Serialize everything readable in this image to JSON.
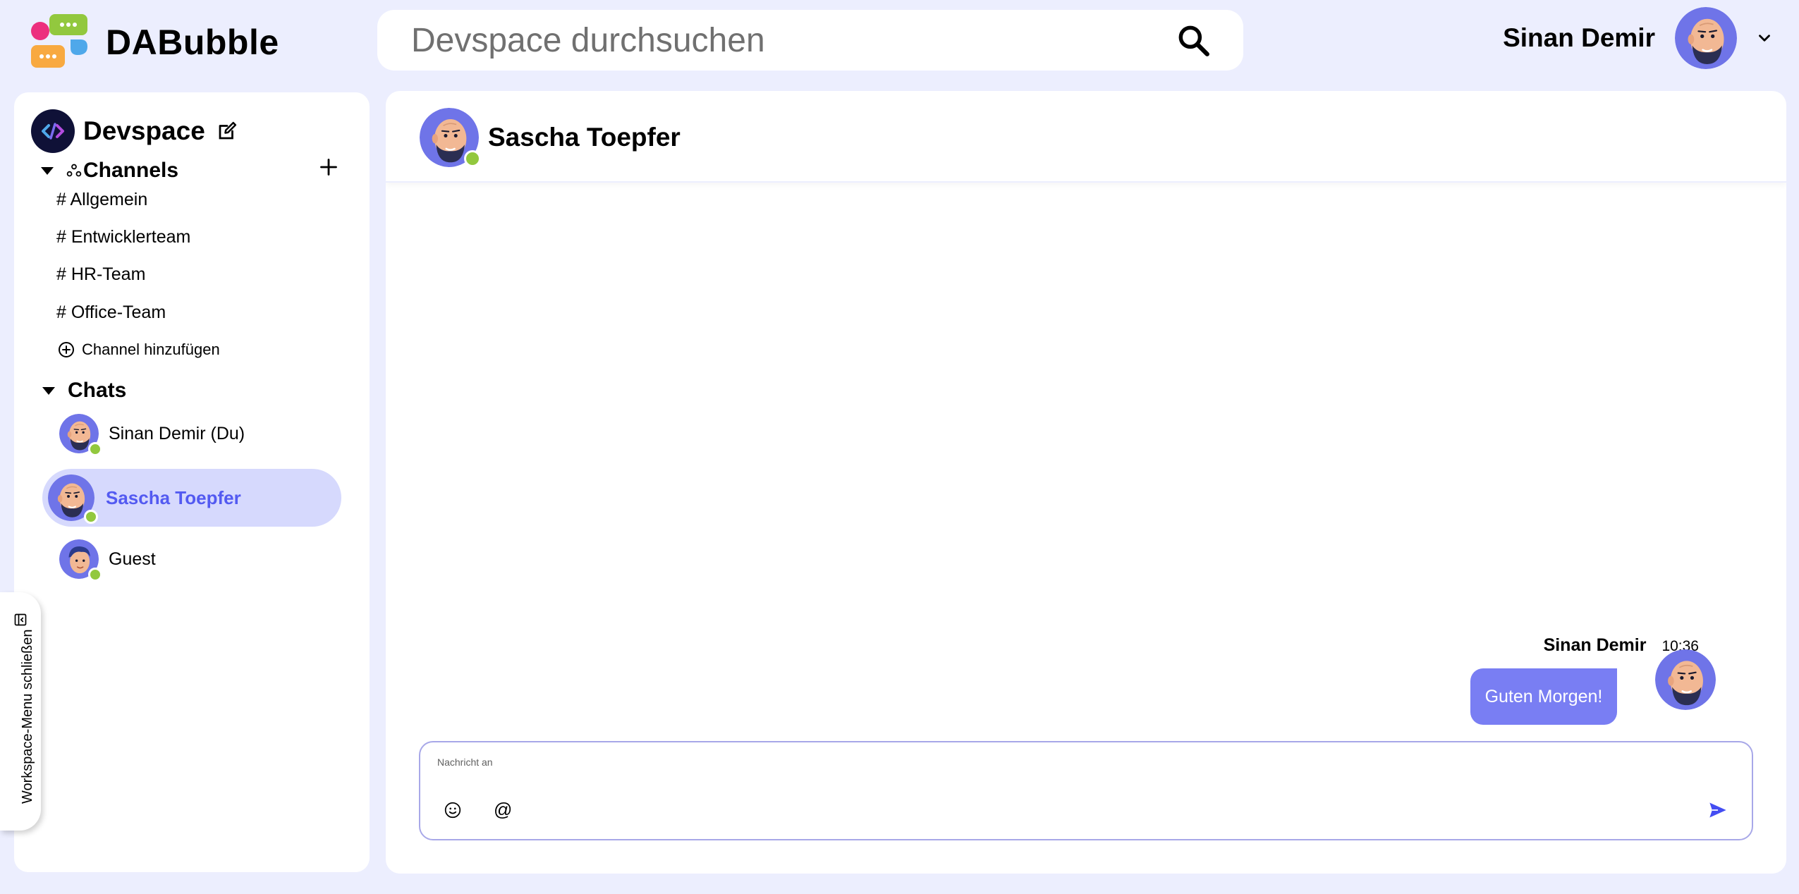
{
  "app": {
    "name": "DABubble"
  },
  "search": {
    "placeholder": "Devspace durchsuchen",
    "icon": "search-icon"
  },
  "current_user": {
    "name": "Sinan Demir",
    "menu_icon": "chevron-down-icon"
  },
  "sidebar": {
    "workspace_name": "Devspace",
    "channels_heading": "Channels",
    "channels": [
      {
        "label": "# Allgemein"
      },
      {
        "label": "# Entwicklerteam"
      },
      {
        "label": "# HR-Team"
      },
      {
        "label": "# Office-Team"
      }
    ],
    "add_channel_label": "Channel hinzufügen",
    "chats_heading": "Chats",
    "chats": [
      {
        "label": "Sinan Demir (Du)",
        "status": "online",
        "active": false
      },
      {
        "label": "Sascha Toepfer",
        "status": "online",
        "active": true
      },
      {
        "label": "Guest",
        "status": "online",
        "active": false
      }
    ],
    "toggle_label": "Workspace-Menu schließen"
  },
  "conversation": {
    "partner_name": "Sascha Toepfer",
    "partner_status": "online",
    "messages": [
      {
        "author": "Sinan Demir",
        "time": "10:36",
        "text": "Guten Morgen!"
      }
    ]
  },
  "composer": {
    "placeholder": "Nachricht an",
    "emoji_icon": "smiley-icon",
    "mention_label": "@",
    "send_icon": "send-icon"
  },
  "colors": {
    "background": "#eceefe",
    "accent": "#535af1",
    "bubble": "#797ef3",
    "active_item": "#d6d9fd",
    "online": "#92c83e"
  }
}
